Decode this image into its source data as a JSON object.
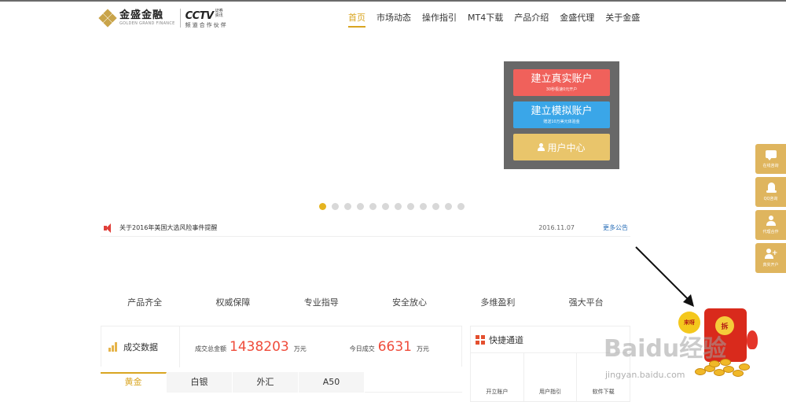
{
  "header": {
    "logo_cn": "金盛金融",
    "logo_en": "GOLDEN GRAND FINANCE",
    "cctv_main": "CCTV",
    "cctv_small_line1": "证券",
    "cctv_small_line2": "资讯",
    "cctv_partner": "频道合作伙伴",
    "nav": [
      {
        "label": "首页",
        "active": true
      },
      {
        "label": "市场动态"
      },
      {
        "label": "操作指引"
      },
      {
        "label": "MT4下载"
      },
      {
        "label": "产品介绍"
      },
      {
        "label": "金盛代理"
      },
      {
        "label": "关于金盛"
      }
    ]
  },
  "account_box": {
    "real_label": "建立真实账户",
    "real_sub": "30秒极速0元开户",
    "demo_label": "建立模拟账户",
    "demo_sub": "赠送10万美元体验金",
    "user_label": "用户中心"
  },
  "carousel": {
    "count": 12,
    "active_index": 0
  },
  "notice": {
    "text": "关于2016年美国大选风险事件提醒",
    "date": "2016.11.07",
    "more": "更多公告"
  },
  "features": [
    "产品齐全",
    "权威保障",
    "专业指导",
    "安全放心",
    "多维盈利",
    "强大平台"
  ],
  "stats": {
    "title": "成交数据",
    "total_label": "成交总金额",
    "total_value": "1438203",
    "total_unit": "万元",
    "today_label": "今日成交",
    "today_value": "6631",
    "today_unit": "万元"
  },
  "tabs": [
    {
      "label": "黄金",
      "active": true
    },
    {
      "label": "白银"
    },
    {
      "label": "外汇"
    },
    {
      "label": "A50"
    }
  ],
  "quick": {
    "title": "快捷通道",
    "items": [
      "开立账户",
      "用户指引",
      "软件下载"
    ]
  },
  "sidebar": [
    {
      "label": "在线咨询",
      "icon": "chat-icon"
    },
    {
      "label": "QQ咨询",
      "icon": "qq-icon"
    },
    {
      "label": "代理合作",
      "icon": "agent-icon"
    },
    {
      "label": "真实开户",
      "icon": "add-user-icon"
    }
  ],
  "promo": {
    "bubble": "来呀",
    "seal": "拆"
  },
  "watermark": {
    "brand": "Baidu经验",
    "url": "jingyan.baidu.com"
  },
  "colors": {
    "accent": "#d9a521",
    "real_button": "#f0615b",
    "demo_button": "#3aa6e8",
    "user_button": "#e9c56b",
    "stat_value": "#ef4c3b",
    "sidebar": "#dfb55e"
  }
}
